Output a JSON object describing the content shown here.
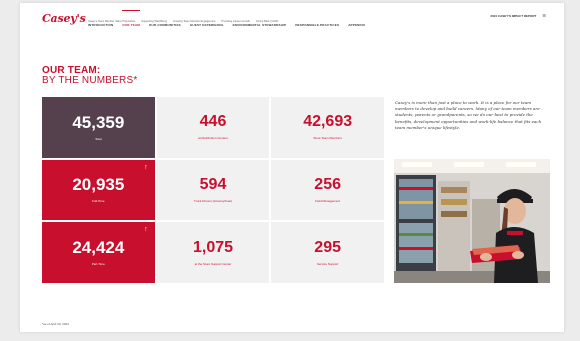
{
  "brand": {
    "logo": "Casey's"
  },
  "nav": {
    "items": [
      {
        "label": "INTRODUCTION",
        "active": false
      },
      {
        "label": "OUR TEAM",
        "active": true
      },
      {
        "label": "OUR COMMUNITIES",
        "active": false
      },
      {
        "label": "GUEST EXPERIENCE",
        "active": false
      },
      {
        "label": "ENVIRONMENTAL STEWARDSHIP",
        "active": false
      },
      {
        "label": "RESPONSIBLE PRACTICES",
        "active": false
      },
      {
        "label": "APPENDIX",
        "active": false
      }
    ],
    "subitems": [
      "Casey's Team Member Value Proposition",
      "Supporting Well-Being",
      "Growing Team Member Engagement",
      "Providing Career Growth",
      "Giving Back (CHIP)"
    ],
    "right_label": "2024 CASEY'S IMPACT REPORT",
    "right_icon": "menu-icon"
  },
  "heading": {
    "line1": "OUR TEAM:",
    "line2": "BY THE NUMBERS*"
  },
  "stats": [
    {
      "value": "45,359",
      "label": "Total",
      "style": "dark",
      "arrow": false
    },
    {
      "value": "446",
      "label": "at Distribution Centers",
      "style": "light",
      "arrow": false
    },
    {
      "value": "42,693",
      "label": "Store Team Members",
      "style": "light",
      "arrow": false
    },
    {
      "value": "20,935",
      "label": "Full-Time",
      "style": "red",
      "arrow": true
    },
    {
      "value": "594",
      "label": "Truck Drivers (Grocery/Fuel)",
      "style": "light",
      "arrow": false
    },
    {
      "value": "256",
      "label": "Field Management",
      "style": "light",
      "arrow": false
    },
    {
      "value": "24,424",
      "label": "Part-Time",
      "style": "red",
      "arrow": true
    },
    {
      "value": "1,075",
      "label": "at the Store Support Center",
      "style": "light",
      "arrow": false
    },
    {
      "value": "295",
      "label": "Service Support",
      "style": "light",
      "arrow": false
    }
  ],
  "arrow_glyph": "↑",
  "description": "Casey's is more than just a place to work. It is a place for our team members to develop and build careers. Many of our team members are students, parents or grandparents, so we do our best to provide the benefits, development opportunities and work-life balance that fits each team member's unique lifestyle.",
  "footnote": "*as of April 30, 2024",
  "colors": {
    "brand_red": "#c8102e",
    "dark_plum": "#55404d",
    "cell_gray": "#f1f1f1"
  }
}
